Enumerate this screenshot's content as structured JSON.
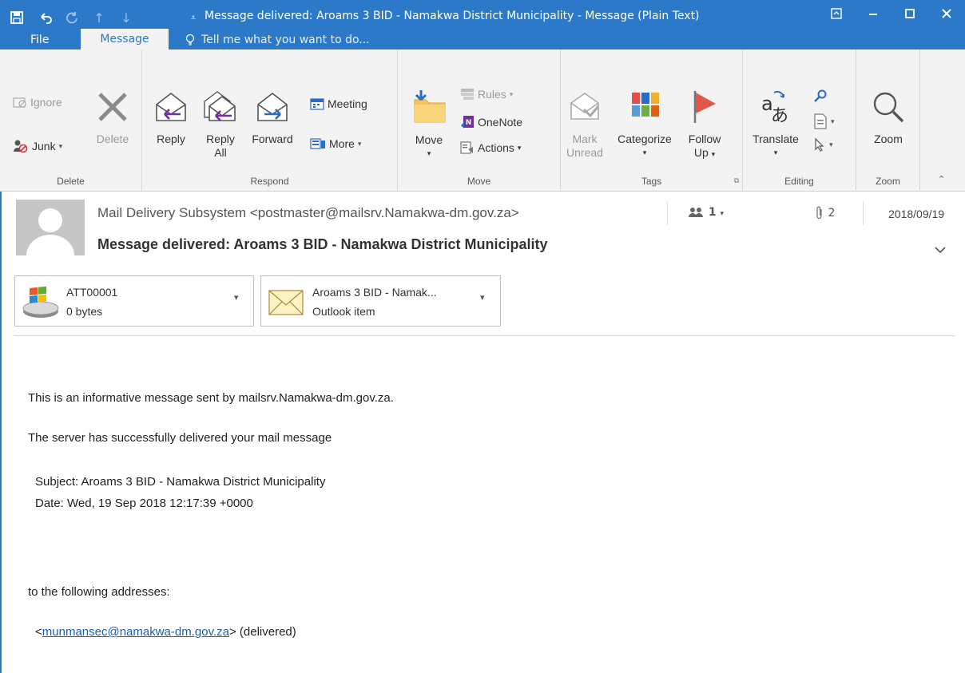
{
  "window": {
    "title": "Message delivered: Aroams 3 BID - Namakwa District Municipality - Message (Plain Text)"
  },
  "tabs": {
    "file": "File",
    "message": "Message",
    "tell_me": "Tell me what you want to do..."
  },
  "ribbon": {
    "delete_group": {
      "label": "Delete",
      "ignore": "Ignore",
      "junk": "Junk",
      "delete": "Delete"
    },
    "respond_group": {
      "label": "Respond",
      "reply": "Reply",
      "reply_all_1": "Reply",
      "reply_all_2": "All",
      "forward": "Forward",
      "meeting": "Meeting",
      "more": "More"
    },
    "move_group": {
      "label": "Move",
      "move": "Move",
      "rules": "Rules",
      "onenote": "OneNote",
      "actions": "Actions"
    },
    "tags_group": {
      "label": "Tags",
      "mark_unread_1": "Mark",
      "mark_unread_2": "Unread",
      "categorize": "Categorize",
      "follow_up_1": "Follow",
      "follow_up_2": "Up"
    },
    "editing_group": {
      "label": "Editing",
      "translate": "Translate"
    },
    "zoom_group": {
      "label": "Zoom",
      "zoom": "Zoom"
    }
  },
  "message": {
    "sender": "Mail Delivery Subsystem <postmaster@mailsrv.Namakwa-dm.gov.za>",
    "subject": "Message delivered: Aroams 3 BID - Namakwa District Municipality",
    "people_count": "1",
    "attachment_count": "2",
    "date": "2018/09/19"
  },
  "attachments": [
    {
      "name": "ATT00001",
      "detail": "0 bytes"
    },
    {
      "name": "Aroams 3 BID - Namak...",
      "detail": "Outlook item"
    }
  ],
  "body": {
    "line1": "This is an informative message sent by mailsrv.Namakwa-dm.gov.za.",
    "line2": "The server has successfully delivered your mail message",
    "subject_line": "Subject: Aroams 3 BID - Namakwa District Municipality",
    "date_line": "Date: Wed, 19 Sep 2018 12:17:39 +0000",
    "addresses_intro": "to the following addresses:",
    "address": "munmansec@namakwa-dm.gov.za",
    "address_prefix": "<",
    "address_suffix": "> (delivered)"
  },
  "colors": {
    "title_bar": "#2b79c8",
    "ribbon_bg": "#f3f3f3",
    "link": "#1a5fb4"
  }
}
